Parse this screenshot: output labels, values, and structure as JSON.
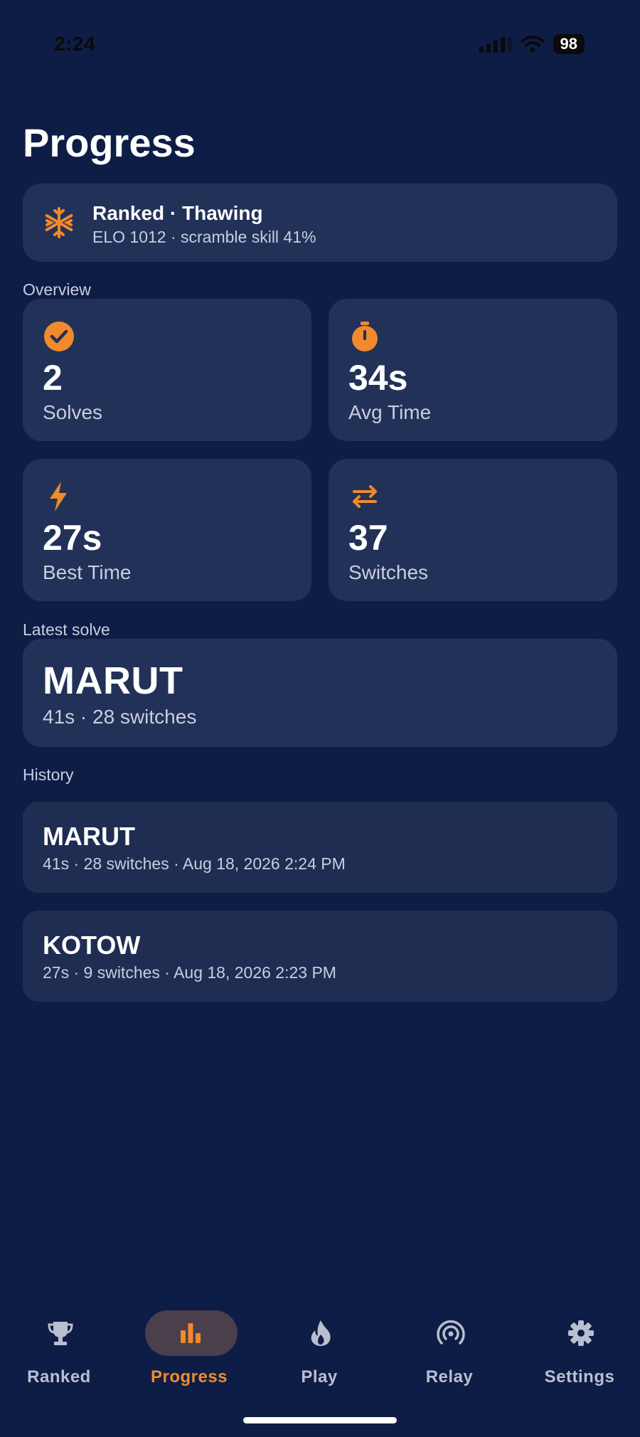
{
  "status_bar": {
    "time": "2:24",
    "battery": "98"
  },
  "page": {
    "title": "Progress"
  },
  "rank": {
    "icon": "snowflake-icon",
    "title": "Ranked · Thawing",
    "subtitle": "ELO 1012 · scramble skill 41%"
  },
  "sections": {
    "overview": "Overview",
    "latest": "Latest solve",
    "history": "History"
  },
  "stats": [
    {
      "icon": "check-circle-icon",
      "value": "2",
      "label": "Solves"
    },
    {
      "icon": "stopwatch-icon",
      "value": "34s",
      "label": "Avg Time"
    },
    {
      "icon": "lightning-icon",
      "value": "27s",
      "label": "Best Time"
    },
    {
      "icon": "swap-arrows-icon",
      "value": "37",
      "label": "Switches"
    }
  ],
  "latest_solve": {
    "word": "MARUT",
    "detail": "41s · 28 switches"
  },
  "history": [
    {
      "word": "MARUT",
      "detail": "41s · 28 switches · Aug 18, 2026 2:24 PM"
    },
    {
      "word": "KOTOW",
      "detail": "27s · 9 switches · Aug 18, 2026 2:23 PM"
    }
  ],
  "tabs": [
    {
      "label": "Ranked",
      "icon": "trophy-icon",
      "active": false
    },
    {
      "label": "Progress",
      "icon": "bar-chart-icon",
      "active": true
    },
    {
      "label": "Play",
      "icon": "flame-icon",
      "active": false
    },
    {
      "label": "Relay",
      "icon": "broadcast-icon",
      "active": false
    },
    {
      "label": "Settings",
      "icon": "gear-icon",
      "active": false
    }
  ],
  "colors": {
    "background": "#0e1d45",
    "card": "#223158",
    "accent": "#f08a2c",
    "muted_text": "#c8cee0"
  }
}
